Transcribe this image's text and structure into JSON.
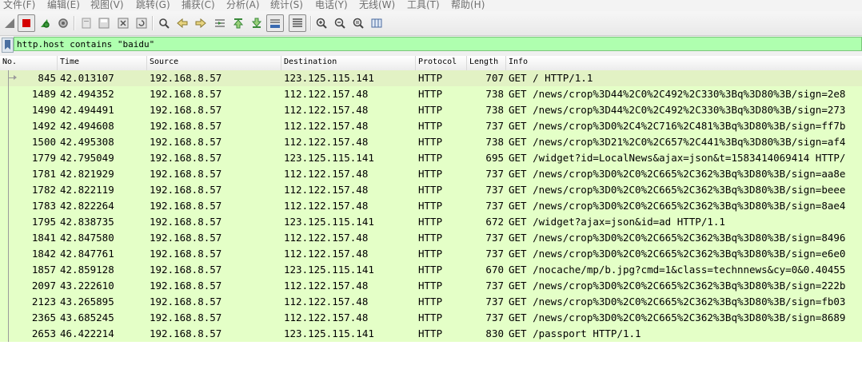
{
  "menu": [
    "文件(F)",
    "编辑(E)",
    "视图(V)",
    "跳转(G)",
    "捕获(C)",
    "分析(A)",
    "统计(S)",
    "电话(Y)",
    "无线(W)",
    "工具(T)",
    "帮助(H)"
  ],
  "toolbar": {
    "icons": [
      "shark-fin-icon",
      "stop-capture-icon",
      "restart-capture-icon",
      "capture-options-icon",
      "open-file-icon",
      "save-file-icon",
      "close-file-icon",
      "reload-icon",
      "find-packet-icon",
      "go-back-icon",
      "go-forward-icon",
      "go-to-packet-icon",
      "go-first-icon",
      "go-last-icon",
      "auto-scroll-icon",
      "colorize-icon",
      "zoom-in-icon",
      "zoom-out-icon",
      "zoom-normal-icon",
      "resize-columns-icon"
    ]
  },
  "filter": {
    "value": "http.host contains \"baidu\""
  },
  "columns": {
    "no": "No.",
    "time": "Time",
    "source": "Source",
    "destination": "Destination",
    "protocol": "Protocol",
    "length": "Length",
    "info": "Info"
  },
  "packets": [
    {
      "no": "845",
      "time": "42.013107",
      "source": "192.168.8.57",
      "destination": "123.125.115.141",
      "protocol": "HTTP",
      "length": "707",
      "info": "GET / HTTP/1.1"
    },
    {
      "no": "1489",
      "time": "42.494352",
      "source": "192.168.8.57",
      "destination": "112.122.157.48",
      "protocol": "HTTP",
      "length": "738",
      "info": "GET /news/crop%3D44%2C0%2C492%2C330%3Bq%3D80%3B/sign=2e8"
    },
    {
      "no": "1490",
      "time": "42.494491",
      "source": "192.168.8.57",
      "destination": "112.122.157.48",
      "protocol": "HTTP",
      "length": "738",
      "info": "GET /news/crop%3D44%2C0%2C492%2C330%3Bq%3D80%3B/sign=273"
    },
    {
      "no": "1492",
      "time": "42.494608",
      "source": "192.168.8.57",
      "destination": "112.122.157.48",
      "protocol": "HTTP",
      "length": "737",
      "info": "GET /news/crop%3D0%2C4%2C716%2C481%3Bq%3D80%3B/sign=ff7b"
    },
    {
      "no": "1500",
      "time": "42.495308",
      "source": "192.168.8.57",
      "destination": "112.122.157.48",
      "protocol": "HTTP",
      "length": "738",
      "info": "GET /news/crop%3D21%2C0%2C657%2C441%3Bq%3D80%3B/sign=af4"
    },
    {
      "no": "1779",
      "time": "42.795049",
      "source": "192.168.8.57",
      "destination": "123.125.115.141",
      "protocol": "HTTP",
      "length": "695",
      "info": "GET /widget?id=LocalNews&ajax=json&t=1583414069414 HTTP/"
    },
    {
      "no": "1781",
      "time": "42.821929",
      "source": "192.168.8.57",
      "destination": "112.122.157.48",
      "protocol": "HTTP",
      "length": "737",
      "info": "GET /news/crop%3D0%2C0%2C665%2C362%3Bq%3D80%3B/sign=aa8e"
    },
    {
      "no": "1782",
      "time": "42.822119",
      "source": "192.168.8.57",
      "destination": "112.122.157.48",
      "protocol": "HTTP",
      "length": "737",
      "info": "GET /news/crop%3D0%2C0%2C665%2C362%3Bq%3D80%3B/sign=beee"
    },
    {
      "no": "1783",
      "time": "42.822264",
      "source": "192.168.8.57",
      "destination": "112.122.157.48",
      "protocol": "HTTP",
      "length": "737",
      "info": "GET /news/crop%3D0%2C0%2C665%2C362%3Bq%3D80%3B/sign=8ae4"
    },
    {
      "no": "1795",
      "time": "42.838735",
      "source": "192.168.8.57",
      "destination": "123.125.115.141",
      "protocol": "HTTP",
      "length": "672",
      "info": "GET /widget?ajax=json&id=ad HTTP/1.1"
    },
    {
      "no": "1841",
      "time": "42.847580",
      "source": "192.168.8.57",
      "destination": "112.122.157.48",
      "protocol": "HTTP",
      "length": "737",
      "info": "GET /news/crop%3D0%2C0%2C665%2C362%3Bq%3D80%3B/sign=8496"
    },
    {
      "no": "1842",
      "time": "42.847761",
      "source": "192.168.8.57",
      "destination": "112.122.157.48",
      "protocol": "HTTP",
      "length": "737",
      "info": "GET /news/crop%3D0%2C0%2C665%2C362%3Bq%3D80%3B/sign=e6e0"
    },
    {
      "no": "1857",
      "time": "42.859128",
      "source": "192.168.8.57",
      "destination": "123.125.115.141",
      "protocol": "HTTP",
      "length": "670",
      "info": "GET /nocache/mp/b.jpg?cmd=1&class=technnews&cy=0&0.40455"
    },
    {
      "no": "2097",
      "time": "43.222610",
      "source": "192.168.8.57",
      "destination": "112.122.157.48",
      "protocol": "HTTP",
      "length": "737",
      "info": "GET /news/crop%3D0%2C0%2C665%2C362%3Bq%3D80%3B/sign=222b"
    },
    {
      "no": "2123",
      "time": "43.265895",
      "source": "192.168.8.57",
      "destination": "112.122.157.48",
      "protocol": "HTTP",
      "length": "737",
      "info": "GET /news/crop%3D0%2C0%2C665%2C362%3Bq%3D80%3B/sign=fb03"
    },
    {
      "no": "2365",
      "time": "43.685245",
      "source": "192.168.8.57",
      "destination": "112.122.157.48",
      "protocol": "HTTP",
      "length": "737",
      "info": "GET /news/crop%3D0%2C0%2C665%2C362%3Bq%3D80%3B/sign=8689"
    },
    {
      "no": "2653",
      "time": "46.422214",
      "source": "192.168.8.57",
      "destination": "123.125.115.141",
      "protocol": "HTTP",
      "length": "830",
      "info": "GET /passport HTTP/1.1"
    }
  ],
  "colors": {
    "http_row": "#e4ffc7",
    "filter_valid": "#afffaf"
  }
}
